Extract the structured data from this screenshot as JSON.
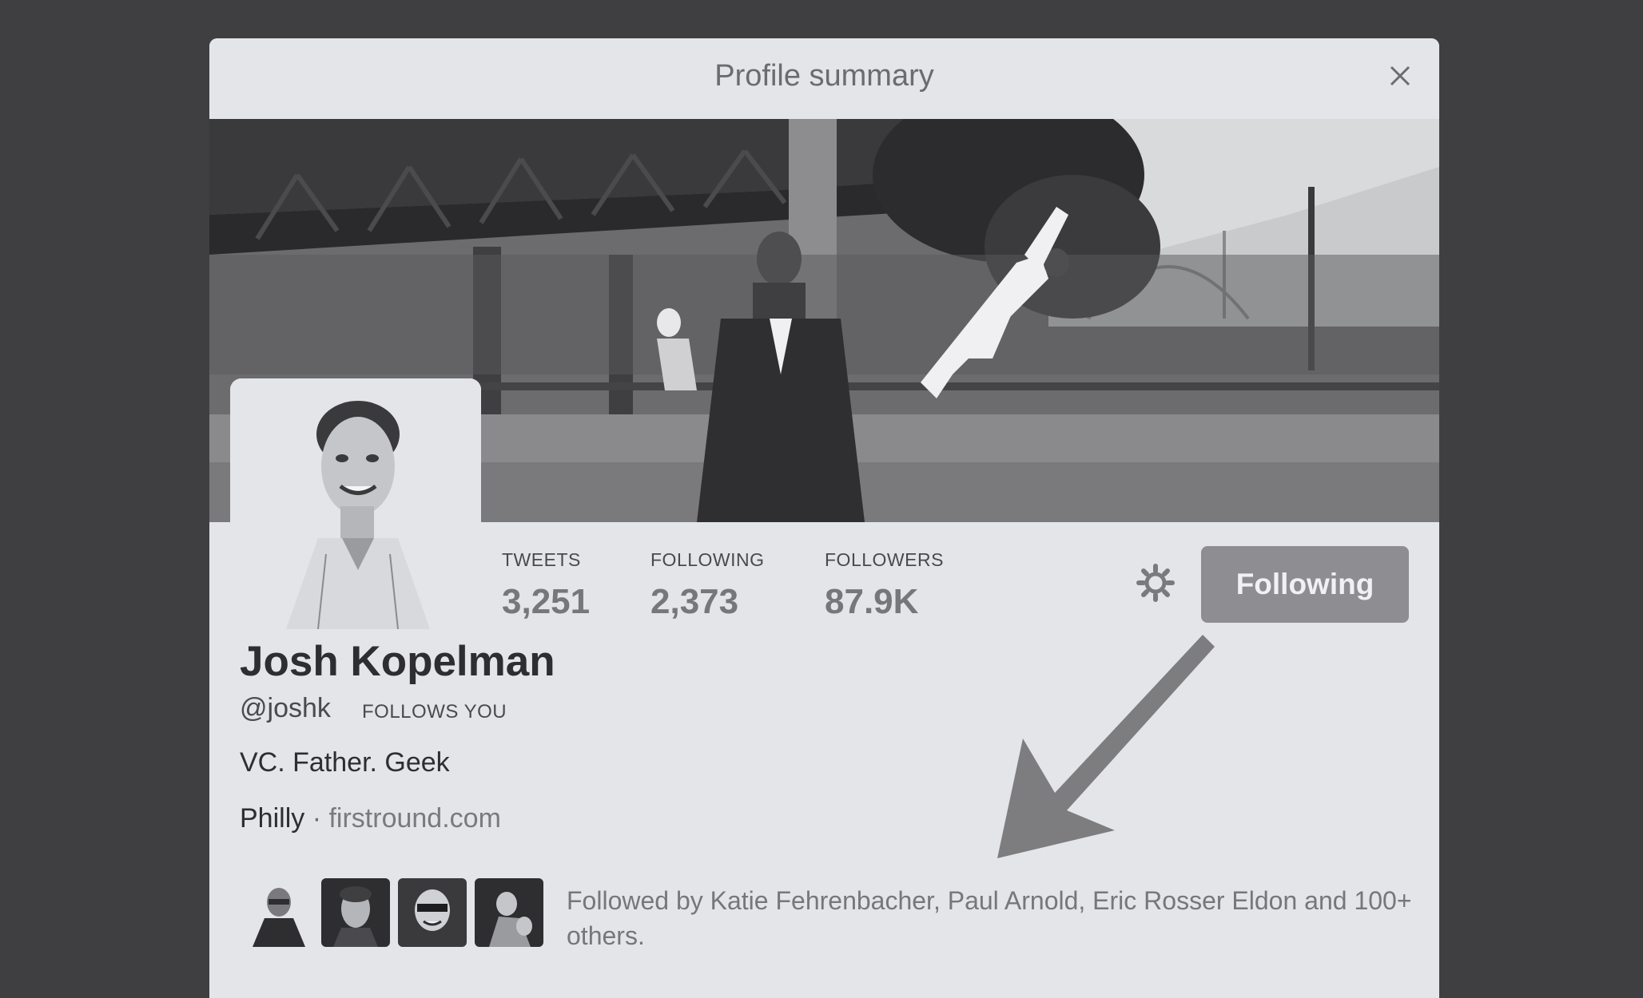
{
  "modal": {
    "title": "Profile summary",
    "close_icon": "close-icon"
  },
  "profile": {
    "name": "Josh Kopelman",
    "handle": "@joshk",
    "follows_you": "FOLLOWS YOU",
    "bio": "VC. Father. Geek",
    "location": "Philly",
    "separator": "·",
    "website": "firstround.com"
  },
  "stats": [
    {
      "label": "TWEETS",
      "value": "3,251"
    },
    {
      "label": "FOLLOWING",
      "value": "2,373"
    },
    {
      "label": "FOLLOWERS",
      "value": "87.9K"
    }
  ],
  "actions": {
    "settings_icon": "gear-icon",
    "follow_button_label": "Following"
  },
  "followed_by": {
    "text": "Followed by Katie Fehrenbacher, Paul Arnold, Eric Rosser Eldon and 100+ others.",
    "avatars": [
      "follower-avatar-1",
      "follower-avatar-2",
      "follower-avatar-3",
      "follower-avatar-4"
    ]
  },
  "colors": {
    "background": "#3f3e40",
    "modal": "#e3e5e9",
    "follow_button": "#8e8e92",
    "arrow": "#7d7d80"
  }
}
